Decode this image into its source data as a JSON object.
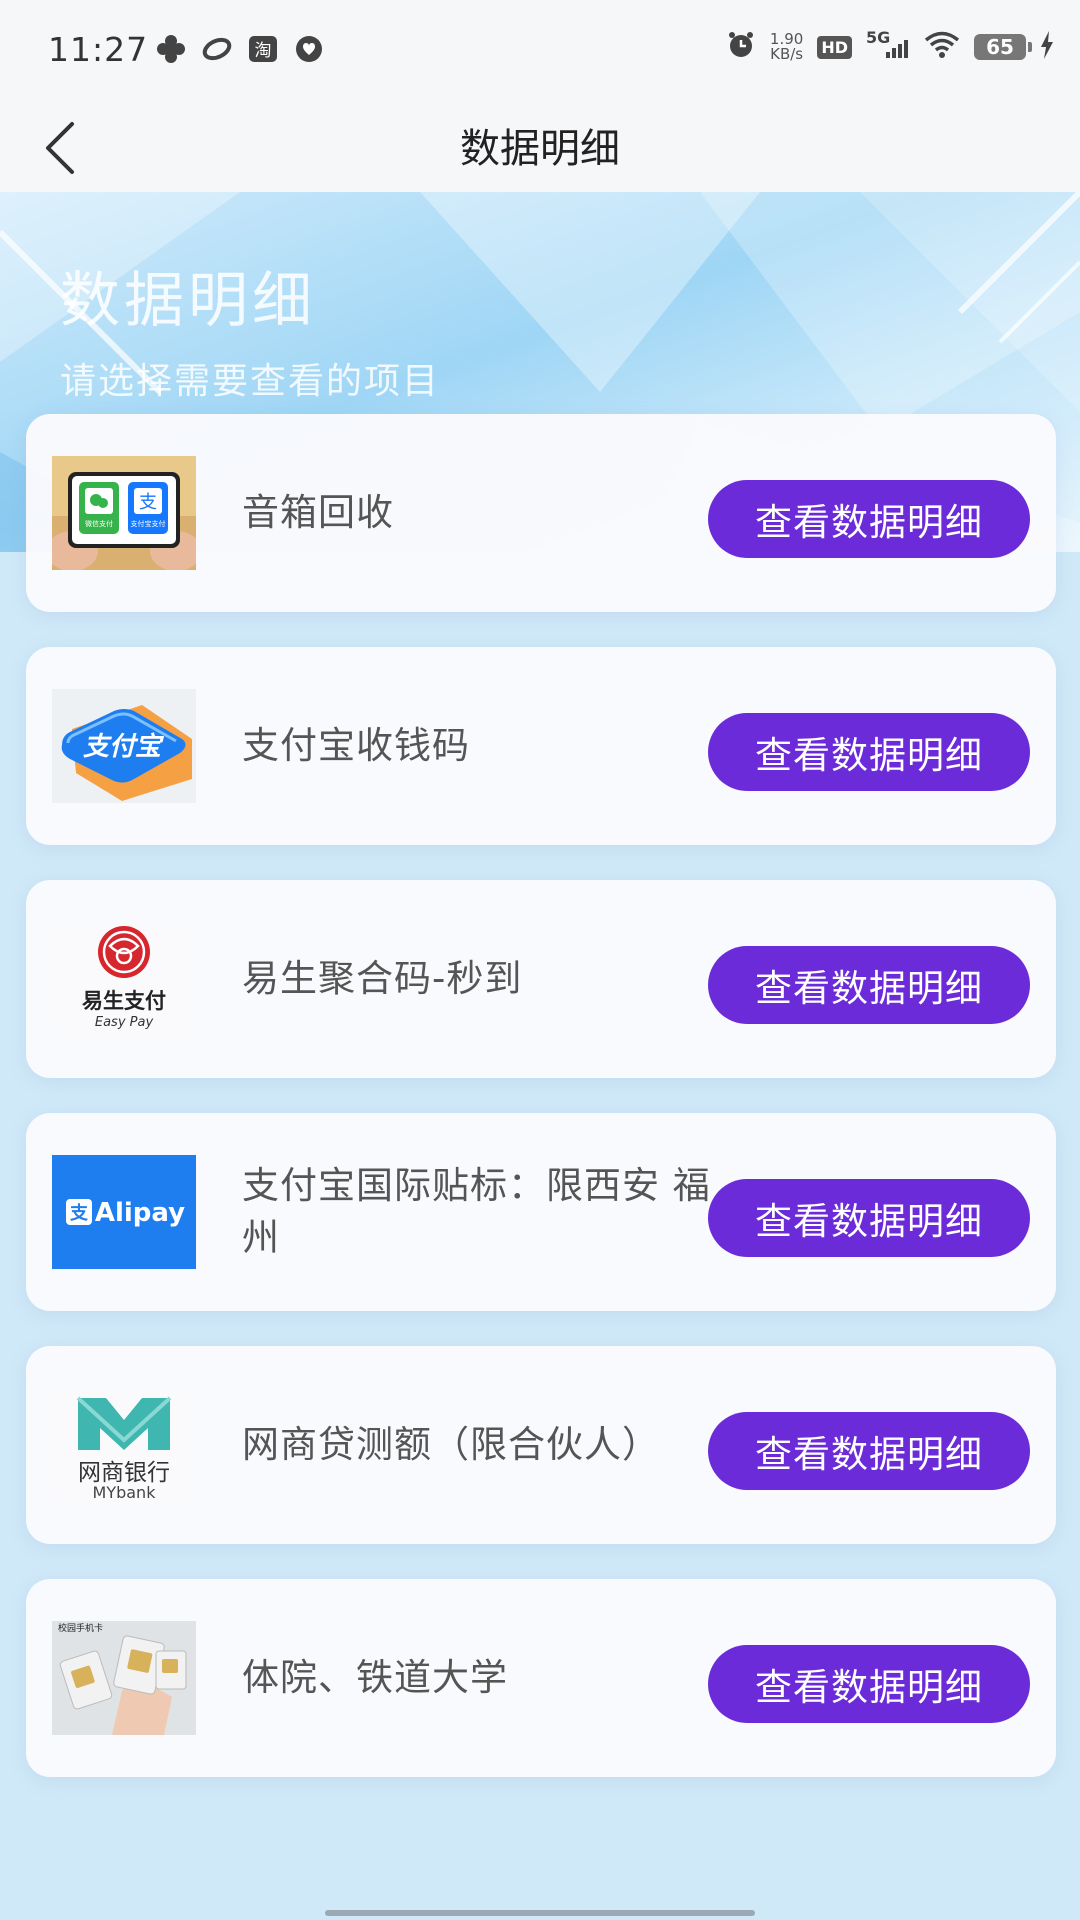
{
  "status_bar": {
    "time": "11:27",
    "net_speed_value": "1.90",
    "net_speed_unit": "KB/s",
    "hd": "HD",
    "network": "5G",
    "battery": "65",
    "left_icons": [
      "fan-app-icon",
      "link-app-icon",
      "taobao-app-icon",
      "heart-app-icon"
    ],
    "taobao_text": "淘"
  },
  "nav": {
    "title": "数据明细"
  },
  "banner": {
    "title": "数据明细",
    "subtitle": "请选择需要查看的项目"
  },
  "items": [
    {
      "label": "音箱回收",
      "button": "查看数据明细",
      "thumb": "speaker-payment-thumbnail",
      "thumb_text_1": "微信支付",
      "thumb_text_2": "支付宝支付"
    },
    {
      "label": "支付宝收钱码",
      "button": "查看数据明细",
      "thumb": "alipay-qr-card-thumbnail",
      "thumb_text": "支付宝"
    },
    {
      "label": "易生聚合码-秒到",
      "button": "查看数据明细",
      "thumb": "easypay-logo",
      "thumb_text": "易生支付",
      "thumb_subtext": "Easy Pay"
    },
    {
      "label": "支付宝国际贴标：限西安 福州",
      "button": "查看数据明细",
      "thumb": "alipay-logo",
      "thumb_text": "Alipay"
    },
    {
      "label": "网商贷测额（限合伙人）",
      "button": "查看数据明细",
      "thumb": "mybank-logo",
      "thumb_text": "网商银行",
      "thumb_subtext": "MYbank"
    },
    {
      "label": "体院、铁道大学",
      "button": "查看数据明细",
      "thumb": "sim-card-thumbnail",
      "thumb_text": "校园手机卡"
    }
  ],
  "colors": {
    "button": "#6c2bd9",
    "alipay_blue": "#1e7ef0",
    "background": "#cfe9f8"
  }
}
